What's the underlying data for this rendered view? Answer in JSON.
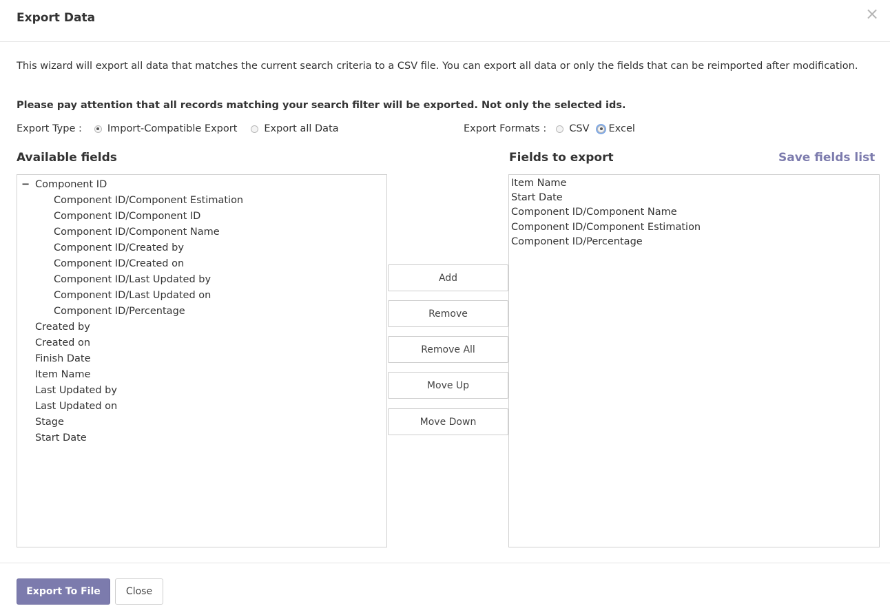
{
  "dialog": {
    "title": "Export Data",
    "close_glyph": "×",
    "description": "This wizard will export all data that matches the current search criteria to a CSV file. You can export all data or only the fields that can be reimported after modification.",
    "warning": "Please pay attention that all records matching your search filter will be exported. Not only the selected ids."
  },
  "export_type": {
    "label": "Export Type :",
    "options": [
      {
        "label": "Import-Compatible Export",
        "checked": true
      },
      {
        "label": "Export all Data",
        "checked": false
      }
    ]
  },
  "export_formats": {
    "label": "Export Formats :",
    "options": [
      {
        "label": "CSV",
        "checked": false
      },
      {
        "label": "Excel",
        "checked": true
      }
    ]
  },
  "available": {
    "title": "Available fields",
    "collapse_glyph": "−",
    "group": {
      "label": "Component ID",
      "children": [
        "Component ID/Component Estimation",
        "Component ID/Component ID",
        "Component ID/Component Name",
        "Component ID/Created by",
        "Component ID/Created on",
        "Component ID/Last Updated by",
        "Component ID/Last Updated on",
        "Component ID/Percentage"
      ]
    },
    "fields": [
      "Created by",
      "Created on",
      "Finish Date",
      "Item Name",
      "Last Updated by",
      "Last Updated on",
      "Stage",
      "Start Date"
    ]
  },
  "to_export": {
    "title": "Fields to export",
    "save_link": "Save fields list",
    "fields": [
      "Item Name",
      "Start Date",
      "Component ID/Component Name",
      "Component ID/Component Estimation",
      "Component ID/Percentage"
    ]
  },
  "actions": {
    "add": "Add",
    "remove": "Remove",
    "remove_all": "Remove All",
    "move_up": "Move Up",
    "move_down": "Move Down"
  },
  "footer": {
    "export_button": "Export To File",
    "close_button": "Close"
  },
  "colors": {
    "accent": "#7c7bad",
    "border": "#d0d0d0"
  }
}
